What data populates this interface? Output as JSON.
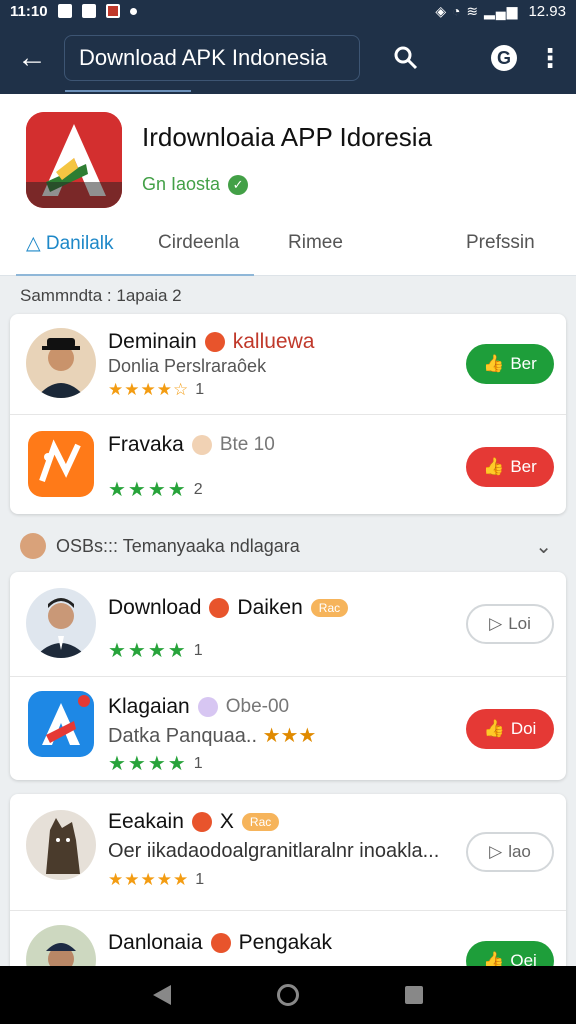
{
  "status": {
    "time": "11:10",
    "right_time": "12.93"
  },
  "appbar": {
    "search_text": "Download APK Indonesia"
  },
  "app": {
    "title": "Irdownloaia APP Idoresia",
    "subtitle": "Gn Iaosta",
    "tabs": [
      "Danilalk",
      "Cirdeenla",
      "Rimee",
      "Prefssin"
    ]
  },
  "section1": {
    "label": "Sammndta : 1apaia 2"
  },
  "section2": {
    "label": "OSBs::: Temanyaaka ndlagara"
  },
  "card1": [
    {
      "name": "Deminain",
      "extra": "kalluewa",
      "sub": "Donlia Perslraraôek",
      "rating_stars": "★★★★☆",
      "count": "1",
      "button": "Ber",
      "button_color": "#1e9e3a"
    },
    {
      "name": "Fravaka",
      "extra": "Bte 10",
      "rating_stars": "★★★★",
      "count": "2",
      "button": "Ber",
      "button_color": "#e53935"
    }
  ],
  "card2": [
    {
      "name": "Download",
      "extra": "Daiken",
      "tag": "Rac",
      "rating_stars": "★★★★",
      "count": "1",
      "button": "Loi"
    },
    {
      "name": "Klagaian",
      "extra": "Obe-00",
      "sub": "Datka Panquaa..",
      "sub_stars": "★★★",
      "rating_stars": "★★★★",
      "count": "1",
      "button": "Doi",
      "button_color": "#e53935"
    }
  ],
  "card3": [
    {
      "name": "Eeakain",
      "extra": "X",
      "tag": "Rac",
      "sub": "Oer iikadaodoalgranitlaralnr inoakla...",
      "rating_stars": "★★★★★",
      "count": "1",
      "button": "lao"
    },
    {
      "name": "Danlonaia",
      "extra": "Pengakak",
      "button": "Oei",
      "button_color": "#1e9e3a"
    }
  ]
}
